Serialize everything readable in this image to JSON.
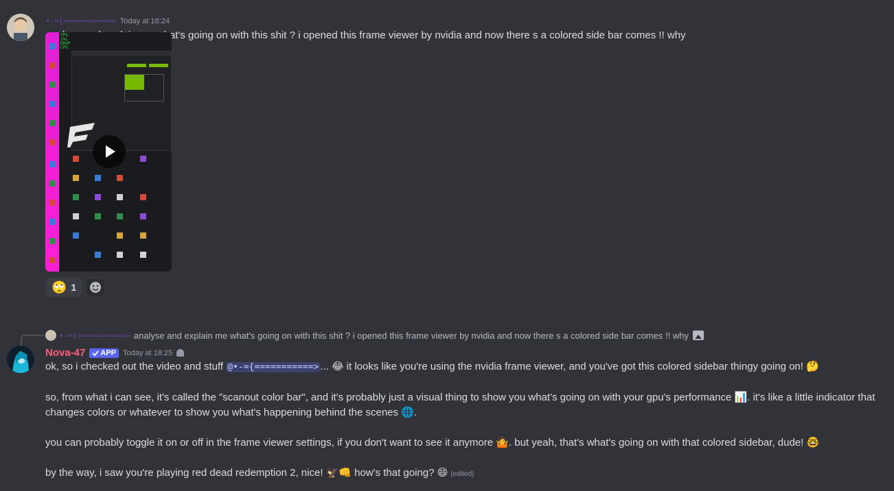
{
  "message1": {
    "username": "•-={===========>",
    "timestamp": "Today at 18:24",
    "text": "analyse and explain me what's going on with this shit ?  i opened this frame viewer by nvidia and now there s a colored side bar comes !! why",
    "video_overlay": "FPS\n1%L\nDROP\nCPU",
    "reactions": [
      {
        "emoji": "🙄",
        "count": "1"
      }
    ]
  },
  "reply": {
    "username": "•-={===========>",
    "text": "analyse and explain me what's going on with this shit ?  i opened this frame viewer by nvidia and now there s a colored side bar comes !! why"
  },
  "message2": {
    "username": "Nova-47",
    "badge": "APP",
    "timestamp": "Today at 18:25",
    "p1_a": "ok, so i checked out the video and stuff ",
    "mention": "@•-={===========>",
    "p1_b": "... 😂 it looks like you're using the nvidia frame viewer, and you've got this colored sidebar thingy going on! 🤔",
    "p2": "so, from what i can see, it's called the \"scanout color bar\", and it's probably just a visual thing to show you what's going on with your gpu's performance 📊. it's like a little indicator that changes colors or whatever to show you what's happening behind the scenes 🌐.",
    "p3": "you can probably toggle it on or off in the frame viewer settings, if you don't want to see it anymore 🤷. but yeah, that's what's going on with that colored sidebar, dude! 🤓",
    "p4": "by the way, i saw you're playing red dead redemption 2, nice! 🦅👊 how's that going? 😄",
    "edited": "(edited)"
  }
}
